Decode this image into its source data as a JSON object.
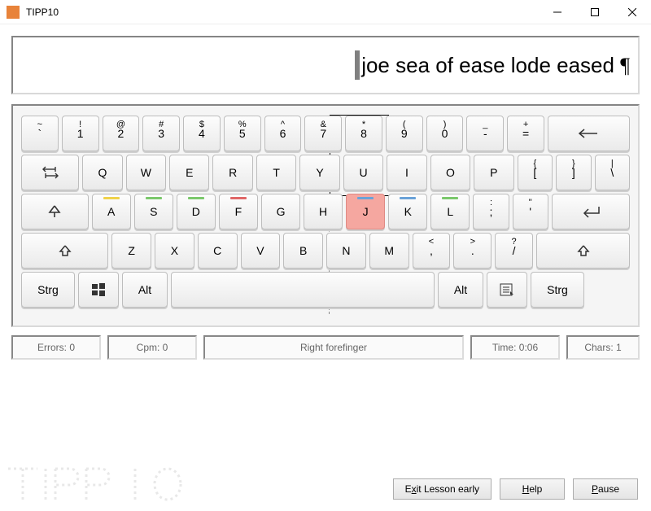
{
  "window": {
    "title": "TIPP10"
  },
  "lesson": {
    "text": "joe sea of ease lode eased "
  },
  "keys": {
    "row1": [
      {
        "top": "~",
        "main": "`"
      },
      {
        "top": "!",
        "main": "1"
      },
      {
        "top": "@",
        "main": "2"
      },
      {
        "top": "#",
        "main": "3"
      },
      {
        "top": "$",
        "main": "4"
      },
      {
        "top": "%",
        "main": "5"
      },
      {
        "top": "^",
        "main": "6"
      },
      {
        "top": "&",
        "main": "7"
      },
      {
        "top": "*",
        "main": "8"
      },
      {
        "top": "(",
        "main": "9"
      },
      {
        "top": ")",
        "main": "0"
      },
      {
        "top": "_",
        "main": "-"
      },
      {
        "top": "+",
        "main": "="
      }
    ],
    "row2": [
      "Q",
      "W",
      "E",
      "R",
      "T",
      "Y",
      "U",
      "I",
      "O",
      "P"
    ],
    "row2_brackets": [
      {
        "top": "{",
        "main": "["
      },
      {
        "top": "}",
        "main": "]"
      },
      {
        "top": "|",
        "main": "\\"
      }
    ],
    "row3": [
      "A",
      "S",
      "D",
      "F",
      "G",
      "H",
      "J",
      "K",
      "L"
    ],
    "row3_extra": [
      {
        "top": ":",
        "main": ";"
      },
      {
        "top": "\"",
        "main": "'"
      }
    ],
    "row4": [
      "Z",
      "X",
      "C",
      "V",
      "B",
      "N",
      "M"
    ],
    "row4_extra": [
      {
        "top": "<",
        "main": ","
      },
      {
        "top": ">",
        "main": "."
      },
      {
        "top": "?",
        "main": "/"
      }
    ],
    "strg": "Strg",
    "alt": "Alt",
    "tab": "⇤⇥",
    "caps": "⇩",
    "shift": "⇧",
    "enter": "↵",
    "back": "⟵"
  },
  "highlighted_key": "J",
  "status": {
    "errors": "Errors: 0",
    "cpm": "Cpm: 0",
    "finger": "Right forefinger",
    "time": "Time: 0:06",
    "chars": "Chars: 1"
  },
  "buttons": {
    "exit": {
      "pre": "E",
      "u": "x",
      "post": "it Lesson early"
    },
    "help": {
      "pre": "",
      "u": "H",
      "post": "elp"
    },
    "pause": {
      "pre": "",
      "u": "P",
      "post": "ause"
    }
  },
  "watermark": "TIPP 10"
}
